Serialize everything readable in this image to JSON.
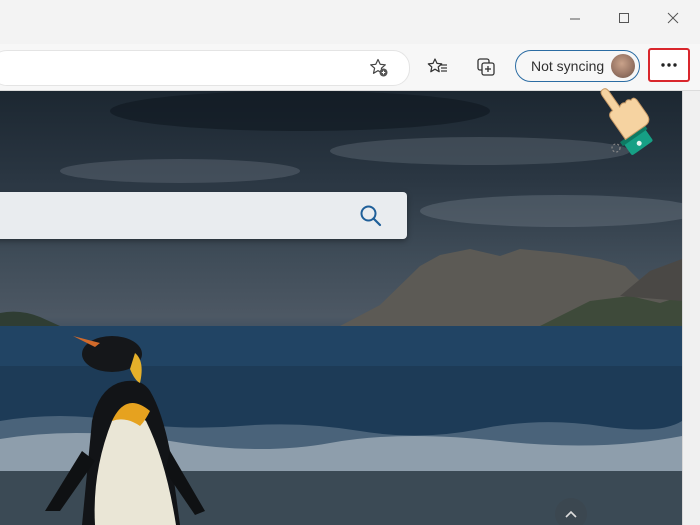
{
  "window": {
    "minimize_label": "minimize",
    "maximize_label": "maximize",
    "close_label": "close"
  },
  "toolbar": {
    "address_value": "",
    "favorites_add_icon": "star-plus-icon",
    "favorites_icon": "favorites-list-icon",
    "collections_icon": "collections-icon",
    "sync_label": "Not syncing",
    "more_icon": "ellipsis-icon"
  },
  "newtab": {
    "search_placeholder": "",
    "search_icon": "search-icon",
    "background": "penguin-beach-photo"
  },
  "colors": {
    "highlight": "#d9262c",
    "sync_border": "#2b6ca3",
    "hand_cursor": "#f6d3a1",
    "cuff": "#16a085"
  }
}
